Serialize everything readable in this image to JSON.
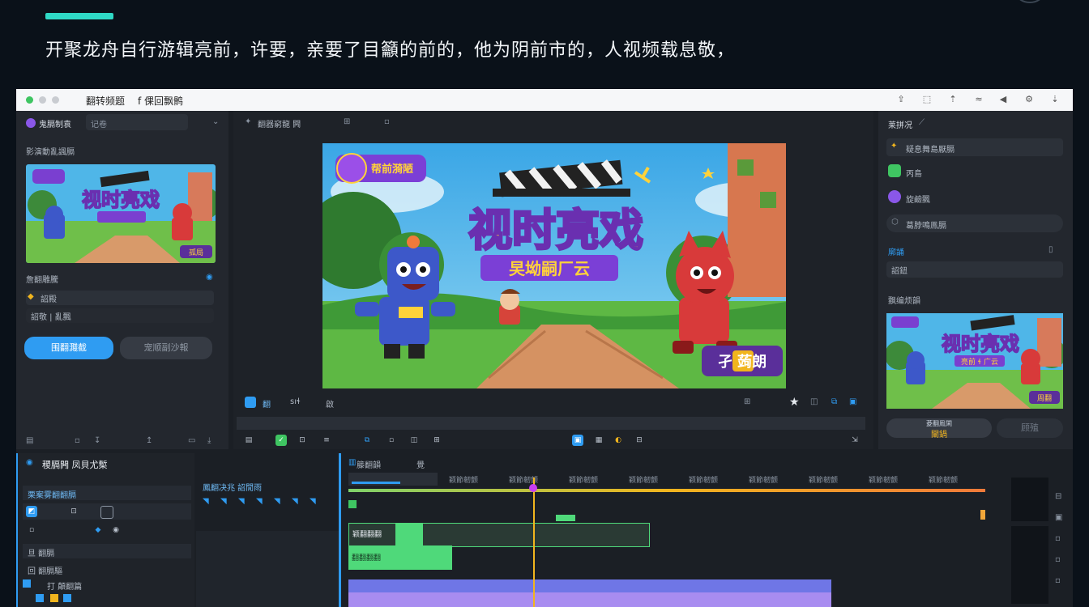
{
  "headline": "开聚龙舟自行游辑亮前，许要，亲要了目籲的前的，他为阴前市的，人视频载息敬，",
  "window": {
    "title": "翻转频题",
    "subtitle": "f 倮回飘鹘"
  },
  "left_panel": {
    "project_name": "鬼膈制袁",
    "search_placeholder": "记卷",
    "section_title": "影演動亂諷膈",
    "thumb_title": "视时亮戏",
    "thumb_badge": "孤局",
    "settings_title": "詹翻雕騰",
    "row1_label": "詔殿",
    "row2_label": "詔敬 | 亂飄",
    "primary_button": "围翻濺截",
    "secondary_button": "宠顺副沙報"
  },
  "toolbar": {
    "label": "翻器窮龍 闁"
  },
  "preview": {
    "logo_text": "帮前漪陋",
    "title": "视时亮戏",
    "subtitle": "旲坳嗣厂云",
    "corner_badge": "孑 蒟朗",
    "btn_a": "翻",
    "btn_b": "sıɬ",
    "btn_c": "啟"
  },
  "right_panel": {
    "header": "莱拼况",
    "item1": "疑息舞島厭膈",
    "item2": "丙島",
    "item3": "旋鹼飄",
    "item4": "葛脖鳴鳯膈",
    "section2": "廓誦",
    "field2": "詔鈕",
    "section3": "飘编烦韻",
    "thumb_title": "视时亮戏",
    "thumb_subtitle": "亮前 ɬ 广云",
    "thumb_badge": "周翻",
    "bottom_button": "闡鍋",
    "bottom_button_caption": "菱翻鳯閑",
    "bottom_button2": "顾殖"
  },
  "timeline": {
    "panel_title": "稷膈闁 凤貝尤槧",
    "sub_title": "栗案雾翻翻膈",
    "mid_label": "鳳翻决兆 詔閒雨",
    "track_header": "籐翻韻",
    "track_header2": "覺",
    "ruler_labels": [
      "颖節韌颤",
      "颖節韌颤",
      "颖節韌颤",
      "颖節韌颤",
      "颖節韌颤",
      "颖節韌颤",
      "颖節韌颤",
      "颖節韌颤",
      "颖節韌颤"
    ],
    "clip1": "颖翻翻翻",
    "clip2": "翻翻翻翻",
    "layers": [
      "旦 翻膈",
      "回 翻膈驅",
      "打 顛翻篇"
    ]
  },
  "colors": {
    "accent": "#2fd9c5",
    "primary_button": "#2f9cf2",
    "playhead": "#f1b51e",
    "clip_green": "#4fd97a",
    "clip_purple": "#a88cf0"
  }
}
